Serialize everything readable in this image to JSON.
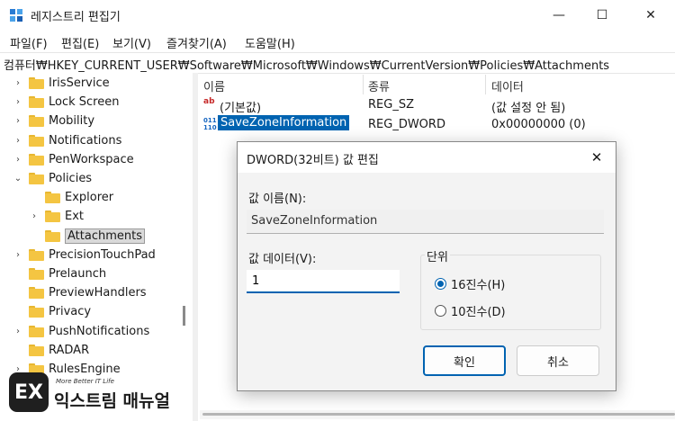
{
  "window": {
    "title": "레지스트리 편집기",
    "icon": "registry-editor-icon",
    "minimize_glyph": "—",
    "maximize_glyph": "☐",
    "close_glyph": "✕"
  },
  "menu": [
    "파일(F)",
    "편집(E)",
    "보기(V)",
    "즐겨찾기(A)",
    "도움말(H)"
  ],
  "address": "컴퓨터₩HKEY_CURRENT_USER₩Software₩Microsoft₩Windows₩CurrentVersion₩Policies₩Attachments",
  "tree": [
    {
      "label": "IrisService",
      "chevron": "›"
    },
    {
      "label": "Lock Screen",
      "chevron": "›"
    },
    {
      "label": "Mobility",
      "chevron": "›"
    },
    {
      "label": "Notifications",
      "chevron": "›"
    },
    {
      "label": "PenWorkspace",
      "chevron": "›"
    },
    {
      "label": "Policies",
      "chevron": "⌄"
    },
    {
      "label": "Explorer",
      "chevron": ""
    },
    {
      "label": "Ext",
      "chevron": "›"
    },
    {
      "label": "Attachments",
      "chevron": ""
    },
    {
      "label": "PrecisionTouchPad",
      "chevron": "›"
    },
    {
      "label": "Prelaunch",
      "chevron": ""
    },
    {
      "label": "PreviewHandlers",
      "chevron": ""
    },
    {
      "label": "Privacy",
      "chevron": ""
    },
    {
      "label": "PushNotifications",
      "chevron": "›"
    },
    {
      "label": "RADAR",
      "chevron": ""
    },
    {
      "label": "RulesEngine",
      "chevron": "›"
    }
  ],
  "list": {
    "columns": [
      "이름",
      "종류",
      "데이터"
    ],
    "rows": [
      {
        "icon": "string-value-icon",
        "icon_text": "ab",
        "name": "(기본값)",
        "type": "REG_SZ",
        "data": "(값 설정 안 됨)"
      },
      {
        "icon": "binary-value-icon",
        "icon_text": "011\n110",
        "name": "SaveZoneInformation",
        "type": "REG_DWORD",
        "data": "0x00000000 (0)"
      }
    ]
  },
  "dialog": {
    "title": "DWORD(32비트) 값 편집",
    "close_glyph": "✕",
    "name_label": "값 이름(N):",
    "name_value": "SaveZoneInformation",
    "data_label": "값 데이터(V):",
    "data_value": "1",
    "unit_label": "단위",
    "radio_hex": "16진수(H)",
    "radio_dec": "10진수(D)",
    "selected_base": "hex",
    "ok_label": "확인",
    "cancel_label": "취소"
  },
  "watermark": {
    "logo_text": "EX",
    "tagline": "More Better IT Life",
    "brand": "익스트림 매뉴얼"
  },
  "colors": {
    "accent": "#0063b1",
    "folder": "#f4c542"
  }
}
